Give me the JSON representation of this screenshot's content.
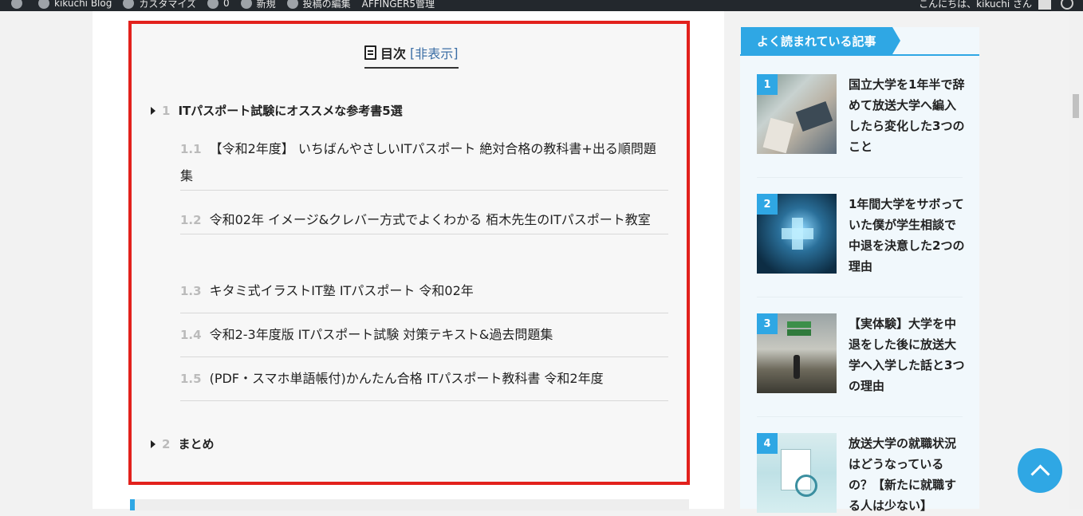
{
  "admin_bar": {
    "items": [
      "kikuchi Blog",
      "カスタマイズ",
      "0",
      "新規",
      "投稿の編集",
      "AFFINGER5管理"
    ],
    "greeting": "こんにちは、kikuchi さん"
  },
  "toc": {
    "title": "目次",
    "toggle_open": "[",
    "toggle_label": "非表示",
    "toggle_close": "]",
    "sections": [
      {
        "num": "1",
        "label": "ITパスポート試験にオススメな参考書5選",
        "children": [
          {
            "num": "1.1",
            "label": "【令和2年度】 いちばんやさしいITパスポート 絶対合格の教科書+出る順問題集"
          },
          {
            "num": "1.2",
            "label": "令和02年 イメージ&クレバー方式でよくわかる 栢木先生のITパスポート教室"
          },
          {
            "num": "1.3",
            "label": "キタミ式イラストIT塾 ITパスポート 令和02年"
          },
          {
            "num": "1.4",
            "label": "令和2-3年度版 ITパスポート試験 対策テキスト&過去問題集"
          },
          {
            "num": "1.5",
            "label": "(PDF・スマホ単語帳付)かんたん合格 ITパスポート教科書 令和2年度"
          }
        ]
      },
      {
        "num": "2",
        "label": "まとめ",
        "children": []
      }
    ]
  },
  "sidebar": {
    "heading": "よく読まれている記事",
    "ranking": [
      {
        "rank": "1",
        "title": "国立大学を1年半で辞めて放送大学へ編入したら変化した3つのこと"
      },
      {
        "rank": "2",
        "title": "1年間大学をサボっていた僕が学生相談で中退を決意した2つの理由"
      },
      {
        "rank": "3",
        "title": "【実体験】大学を中退をした後に放送大学へ入学した話と3つの理由"
      },
      {
        "rank": "4",
        "title": "放送大学の就職状況はどうなっているの？【新たに就職する人は少ない】"
      }
    ]
  },
  "colors": {
    "accent": "#2fa7e4",
    "toc_border": "#e2211c"
  },
  "icons": {
    "toc_title": "document-icon",
    "to_top": "chevron-up-icon"
  }
}
